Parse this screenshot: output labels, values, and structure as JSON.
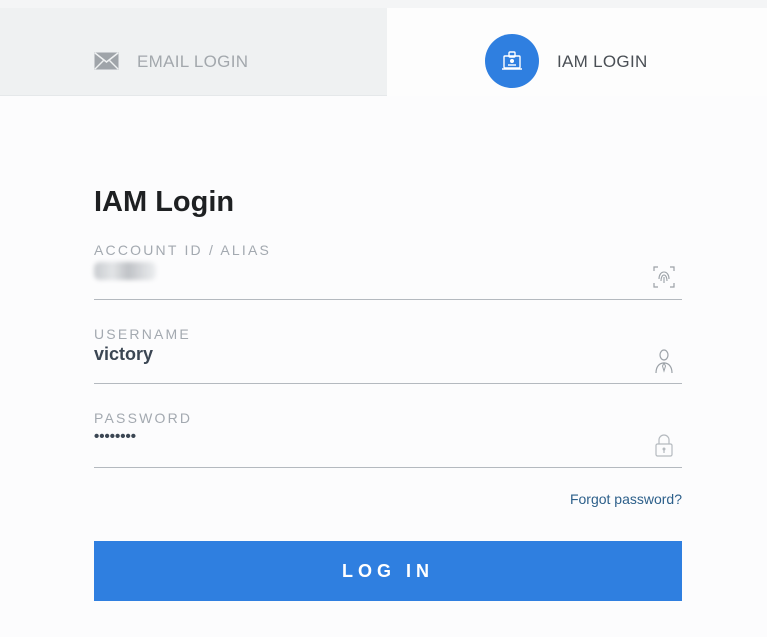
{
  "tabs": {
    "email": {
      "label": "EMAIL LOGIN",
      "icon": "envelope-icon"
    },
    "iam": {
      "label": "IAM LOGIN",
      "icon": "id-badge-icon",
      "active": true
    }
  },
  "form": {
    "title": "IAM Login",
    "account": {
      "label": "ACCOUNT ID / ALIAS",
      "value": "",
      "icon": "fingerprint-icon"
    },
    "username": {
      "label": "USERNAME",
      "value": "victory",
      "icon": "user-icon"
    },
    "password": {
      "label": "PASSWORD",
      "value": "••••••••",
      "icon": "lock-icon"
    },
    "forgot_label": "Forgot password?",
    "submit_label": "LOG IN"
  },
  "colors": {
    "accent": "#2f7fe0",
    "link": "#2c5f8a"
  }
}
